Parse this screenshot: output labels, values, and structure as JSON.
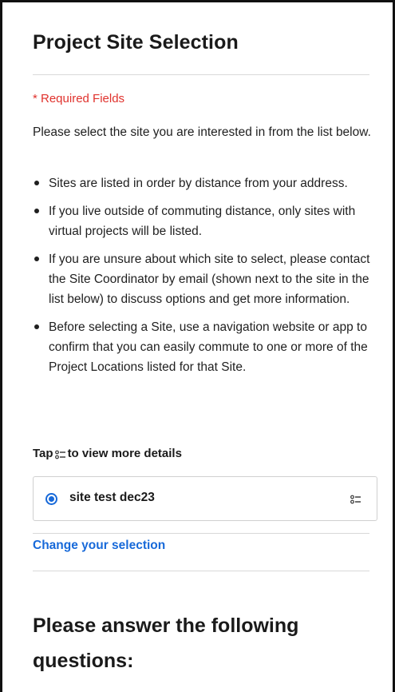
{
  "page": {
    "title": "Project Site Selection",
    "required_note": "* Required Fields",
    "intro": "Please select the site you are interested in from the list below.",
    "bullets": [
      "Sites are listed in order by distance from your address.",
      "If you live outside of commuting distance, only sites with virtual projects will be listed.",
      "If you are unsure about which site to select, please contact the Site Coordinator by email (shown next to the site in the list below) to discuss options and get more information.",
      "Before selecting a Site, use a navigation website or app to confirm that you can easily commute to one or more of the Project Locations listed for that Site."
    ],
    "tap_hint_prefix": "Tap",
    "tap_hint_suffix": "to view more details",
    "selected_site": {
      "name": "site test dec23",
      "selected": true
    },
    "change_link": "Change your selection",
    "next_section_title": "Please answer the following questions:"
  },
  "colors": {
    "accent": "#1769d9",
    "required": "#e0322d",
    "text": "#1f1f1f",
    "divider": "#d9d9d9"
  },
  "icons": {
    "details": "details-list-icon",
    "radio": "radio-selected-icon"
  }
}
